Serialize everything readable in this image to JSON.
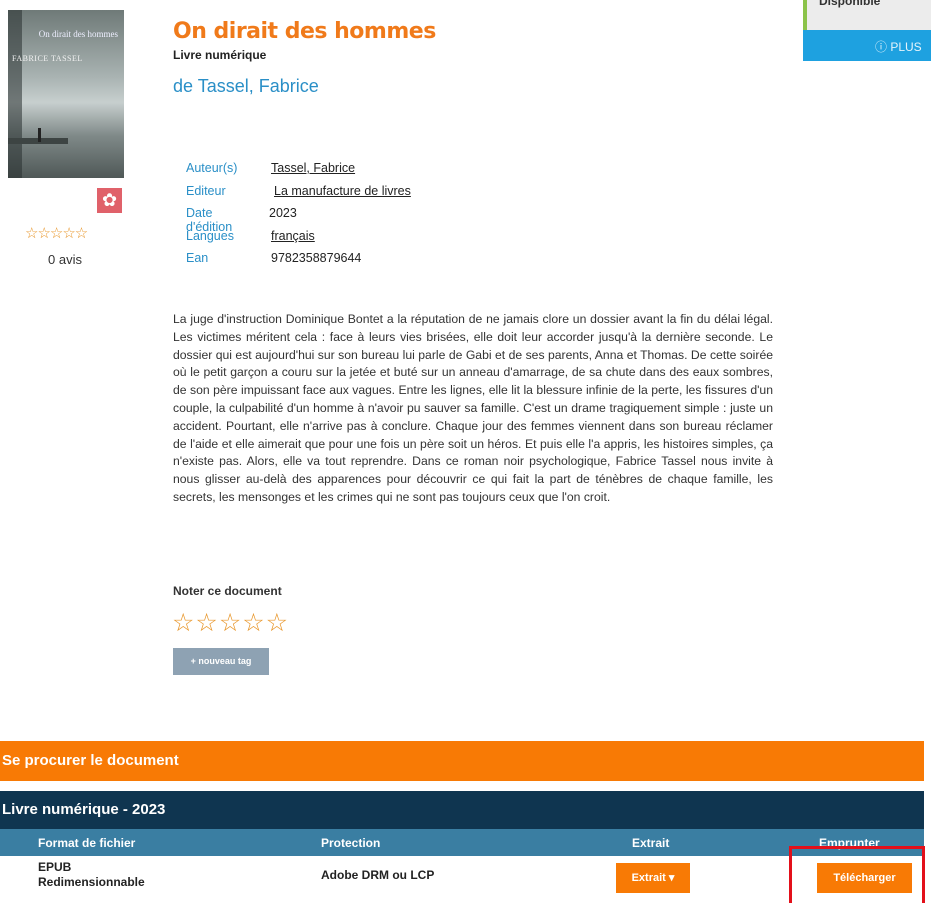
{
  "book": {
    "title": "On dirait des hommes",
    "doc_type": "Livre numérique",
    "author_display": "de Tassel, Fabrice",
    "cover_title": "On dirait des hommes",
    "cover_author": "FABRICE TASSEL",
    "rating_avis": "0 avis",
    "rating_stars": "☆☆☆☆☆"
  },
  "availability": {
    "status": "Disponible",
    "more": "ⓘ PLUS"
  },
  "meta": [
    {
      "label": "Auteur(s)",
      "value": "Tassel, Fabrice"
    },
    {
      "label": "Editeur",
      "value": "La manufacture de livres"
    },
    {
      "label": "Date d'édition",
      "value": "2023"
    },
    {
      "label": "Langues",
      "value": "français"
    },
    {
      "label": "Ean",
      "value": "9782358879644"
    }
  ],
  "description": "La juge d'instruction Dominique Bontet a la réputation de ne jamais clore un dossier avant la fin du délai légal. Les victimes méritent cela : face à leurs vies brisées, elle doit leur accorder jusqu'à la dernière seconde. Le dossier qui est aujourd'hui sur son bureau lui parle de Gabi et de ses parents, Anna et Thomas. De cette soirée où le petit garçon a couru sur la jetée et buté sur un anneau d'amarrage, de sa chute dans des eaux sombres, de son père impuissant face aux vagues. Entre les lignes, elle lit la blessure infinie de la perte, les fissures d'un couple, la culpabilité d'un homme à n'avoir pu sauver sa famille. C'est un drame tragiquement simple : juste un accident. Pourtant, elle n'arrive pas à conclure. Chaque jour des femmes viennent dans son bureau réclamer de l'aide et elle aimerait que pour une fois un père soit un héros. Et puis elle l'a appris, les histoires simples, ça n'existe pas. Alors, elle va tout reprendre. Dans ce roman noir psychologique, Fabrice Tassel nous invite à nous glisser au-delà des apparences pour découvrir ce qui fait la part de ténèbres de chaque famille, les secrets, les mensonges et les crimes qui ne sont pas toujours ceux que l'on croit.",
  "rate": {
    "label": "Noter ce document",
    "stars": "☆☆☆☆☆",
    "tag_button": "+ nouveau tag"
  },
  "procure": {
    "header": "Se procurer le document",
    "edition_header": "Livre numérique - 2023",
    "columns": [
      "Format de fichier",
      "Protection",
      "Extrait",
      "Emprunter"
    ],
    "row": {
      "format_line1": "EPUB",
      "format_line2": "Redimensionnable",
      "protection": "Adobe DRM ou LCP",
      "extrait_button": "Extrait ▾",
      "download_button": "Télécharger"
    }
  },
  "colors": {
    "accent_orange": "#f87a05",
    "link_blue": "#2a8fc7",
    "navy": "#0f3550",
    "table_head": "#3a7ea2",
    "highlight_red": "#e3101a"
  }
}
